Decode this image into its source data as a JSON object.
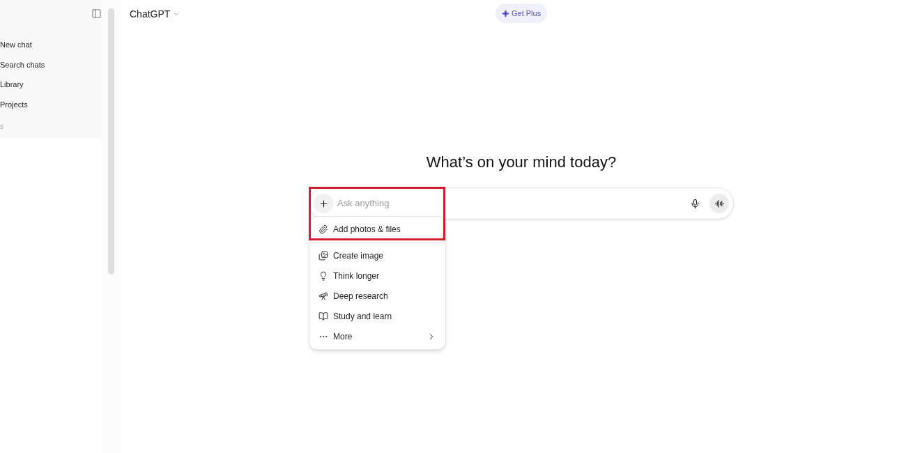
{
  "sidebar": {
    "items": [
      {
        "label": "New chat"
      },
      {
        "label": "Search chats"
      },
      {
        "label": "Library"
      },
      {
        "label": "Projects"
      }
    ],
    "section_label": "s"
  },
  "header": {
    "model": "ChatGPT",
    "upgrade": "Get Plus"
  },
  "heading": "What’s on your mind today?",
  "composer": {
    "placeholder": "Ask anything"
  },
  "annotation": {
    "highlight": true
  },
  "menu": {
    "items": [
      {
        "label": "Add photos & files",
        "has_submenu": false
      },
      {
        "label": "Create image",
        "has_submenu": false
      },
      {
        "label": "Think longer",
        "has_submenu": false
      },
      {
        "label": "Deep research",
        "has_submenu": false
      },
      {
        "label": "Study and learn",
        "has_submenu": false
      },
      {
        "label": "More",
        "has_submenu": true
      }
    ]
  }
}
